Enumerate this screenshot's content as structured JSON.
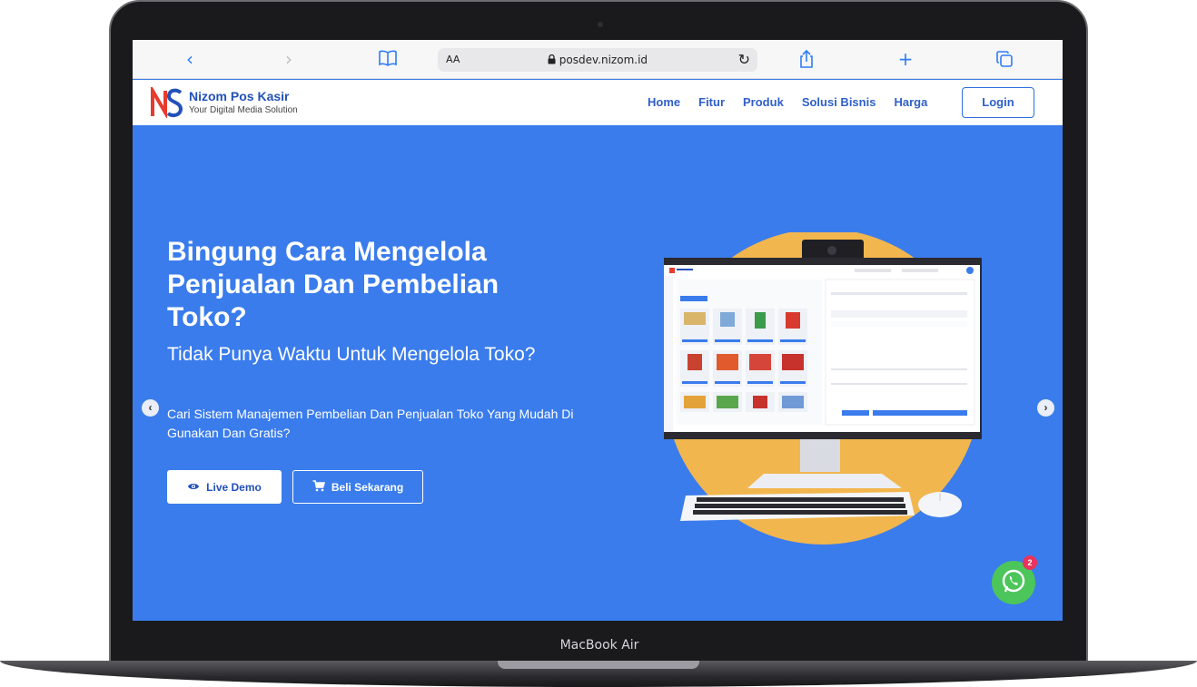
{
  "device": {
    "model_label": "MacBook Air"
  },
  "browser": {
    "text_size_label": "AA",
    "url": "posdev.nizom.id",
    "icons": [
      "back-icon",
      "forward-icon",
      "book-icon",
      "lock-icon",
      "reload-icon",
      "share-icon",
      "new-tab-icon",
      "tabs-icon"
    ]
  },
  "site": {
    "brand_name": "Nizom Pos Kasir",
    "brand_tagline": "Your Digital Media Solution",
    "nav": [
      "Home",
      "Fitur",
      "Produk",
      "Solusi Bisnis",
      "Harga"
    ],
    "login_label": "Login"
  },
  "hero": {
    "headline": "Bingung Cara Mengelola Penjualan Dan Pembelian Toko?",
    "subheadline": "Tidak Punya Waktu Untuk Mengelola Toko?",
    "description": "Cari Sistem Manajemen Pembelian Dan Penjualan Toko Yang Mudah Di Gunakan Dan Gratis?",
    "demo_label": "Live Demo",
    "buy_label": "Beli Sekarang"
  },
  "whatsapp": {
    "badge_count": "2"
  },
  "colors": {
    "hero_bg": "#3a7cec",
    "brand_blue": "#2251b8",
    "circle": "#f2b64e",
    "whatsapp": "#4cc55a",
    "badge": "#e8345c"
  }
}
